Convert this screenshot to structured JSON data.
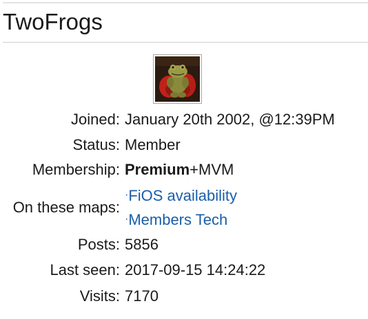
{
  "profile": {
    "username": "TwoFrogs",
    "avatar_icon": "frog-avatar-icon"
  },
  "fields": {
    "joined": {
      "label": "Joined:",
      "value": "January 20th 2002, @12:39PM"
    },
    "status": {
      "label": "Status:",
      "value": "Member"
    },
    "membership": {
      "label": "Membership:",
      "value_bold": "Premium",
      "value_rest": "+MVM"
    },
    "maps": {
      "label": "On these maps:",
      "bullet": "·",
      "links": [
        "FiOS availability",
        "Members Tech"
      ]
    },
    "posts": {
      "label": "Posts:",
      "value": "5856"
    },
    "last_seen": {
      "label": "Last seen:",
      "value": "2017-09-15 14:24:22"
    },
    "visits": {
      "label": "Visits:",
      "value": "7170"
    }
  },
  "colors": {
    "link": "#1a5ea8",
    "text": "#1a1a1a",
    "rule": "#cfcfcf"
  }
}
